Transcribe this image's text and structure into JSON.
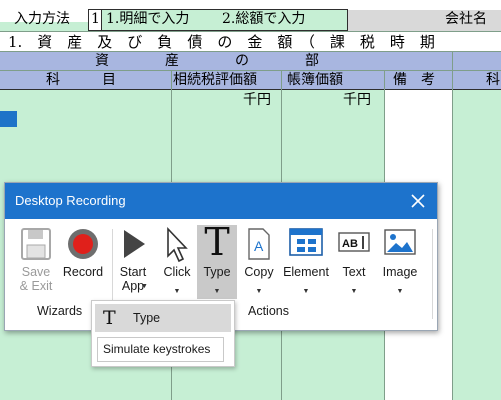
{
  "sheet": {
    "input_method_label": "入力方法",
    "input_value": "1",
    "option_1": "1.明細で入力",
    "option_2": "2.総額で入力",
    "company_label": "会社名",
    "section_title": "1.　資　産　及　び　負　債　の　金　額　（　課　税　時　期",
    "assets_header": "資　　　　産　　　　の　　　　部",
    "columns": {
      "account": "科　　　目",
      "inheritance_value": "相続税評価額",
      "book_value": "帳簿価額",
      "remarks": "備　考",
      "right_partial": "科"
    },
    "units": {
      "inheritance": "千円",
      "book": "千円"
    }
  },
  "dialog": {
    "title": "Desktop Recording",
    "buttons": [
      {
        "label": "Save\n& Exit",
        "icon": "floppy-disk-icon",
        "enabled": false
      },
      {
        "label": "Record",
        "icon": "record-icon",
        "enabled": true
      },
      {
        "label": "Start\nApp",
        "icon": "play-icon",
        "enabled": true
      },
      {
        "label": "Click",
        "icon": "cursor-icon",
        "enabled": true
      },
      {
        "label": "Type",
        "icon": "type-icon",
        "enabled": true,
        "active": true
      },
      {
        "label": "Copy",
        "icon": "copy-icon",
        "enabled": true
      },
      {
        "label": "Element",
        "icon": "element-icon",
        "enabled": true
      },
      {
        "label": "Text",
        "icon": "text-icon",
        "enabled": true
      },
      {
        "label": "Image",
        "icon": "image-icon",
        "enabled": true
      }
    ],
    "groups": {
      "wizards": "Wizards",
      "actions": "Actions"
    },
    "colors": {
      "title_bar": "#1d73cc",
      "record_red": "#e0201b",
      "active_button": "#c9c9c9"
    }
  },
  "menu": {
    "icon_glyph": "T",
    "item_label": "Type",
    "tooltip": "Simulate keystrokes"
  }
}
